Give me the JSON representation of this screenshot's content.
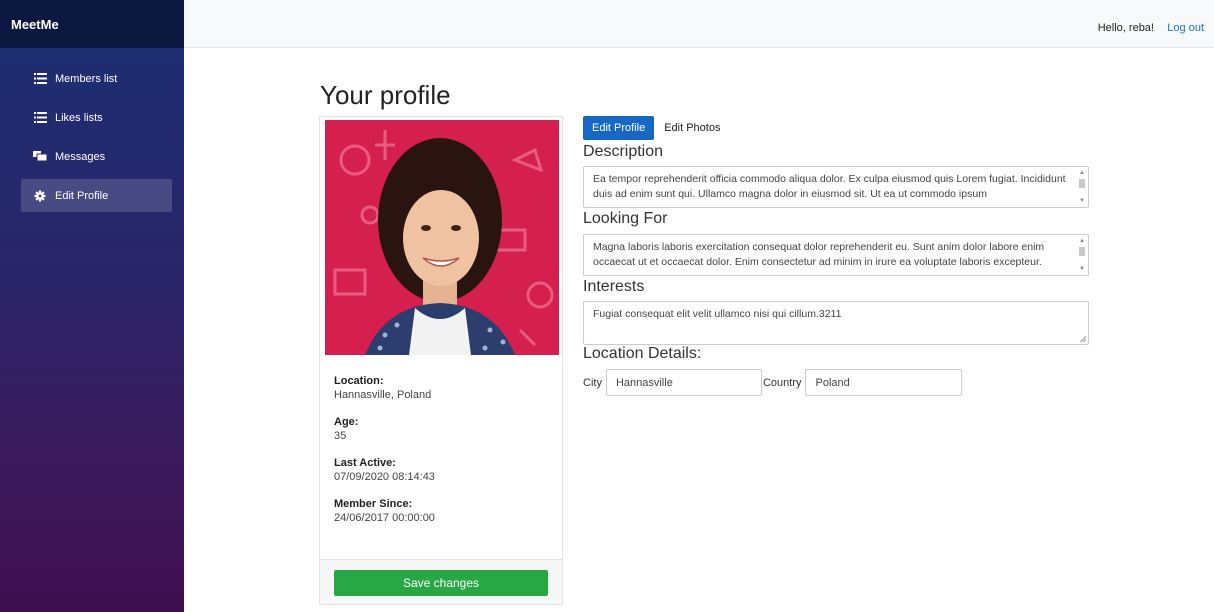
{
  "sidebar": {
    "brand": "MeetMe",
    "items": [
      {
        "label": "Members list",
        "icon": "list-icon"
      },
      {
        "label": "Likes lists",
        "icon": "list-icon"
      },
      {
        "label": "Messages",
        "icon": "messages-icon"
      },
      {
        "label": "Edit Profile",
        "icon": "gear-icon",
        "active": true
      }
    ]
  },
  "topbar": {
    "greeting": "Hello, reba!",
    "logout": "Log out"
  },
  "page": {
    "title": "Your profile"
  },
  "card": {
    "details": [
      {
        "label": "Location:",
        "value": "Hannasville, Poland"
      },
      {
        "label": "Age:",
        "value": "35"
      },
      {
        "label": "Last Active:",
        "value": "07/09/2020 08:14:43"
      },
      {
        "label": "Member Since:",
        "value": "24/06/2017 00:00:00"
      }
    ],
    "save_label": "Save changes"
  },
  "tabs": [
    {
      "label": "Edit Profile",
      "active": true
    },
    {
      "label": "Edit Photos",
      "active": false
    }
  ],
  "form": {
    "description_heading": "Description",
    "description_text": "Ea tempor reprehenderit officia commodo aliqua dolor. Ex culpa eiusmod quis Lorem fugiat. Incididunt duis ad enim sunt qui. Ullamco magna dolor in eiusmod sit. Ut ea ut commodo ipsum",
    "looking_for_heading": "Looking For",
    "looking_for_text": "Magna laboris laboris exercitation consequat dolor reprehenderit eu. Sunt anim dolor labore enim occaecat ut et occaecat dolor. Enim consectetur ad minim in irure ea voluptate laboris excepteur.",
    "interests_heading": "Interests",
    "interests_text": "Fugiat consequat elit velit ullamco nisi qui cillum.3211",
    "location_heading": "Location Details:",
    "city_label": "City",
    "city_value": "Hannasville",
    "country_label": "Country",
    "country_value": "Poland"
  },
  "colors": {
    "primary": "#1768c4",
    "success": "#28a745",
    "sidebar_top": "#1c2f73",
    "sidebar_bottom": "#3f0f4f",
    "photo_background": "#d41f4f"
  }
}
